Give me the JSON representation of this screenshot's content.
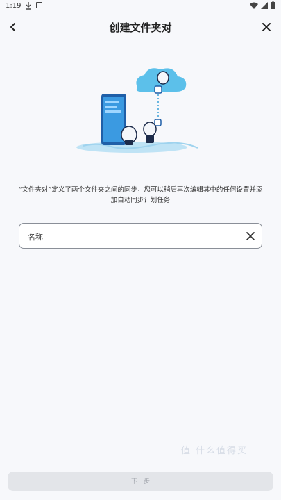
{
  "status_bar": {
    "time": "1:19"
  },
  "header": {
    "title": "创建文件夹对"
  },
  "description": "“文件夹对”定义了两个文件夹之间的同步，您可以稍后再次编辑其中的任何设置并添加自动同步计划任务",
  "name_field": {
    "placeholder": "名称",
    "value": ""
  },
  "footer": {
    "next_label": "下一步"
  },
  "watermark": "值 什么值得买",
  "colors": {
    "accent": "#3aa0d8",
    "background": "#f7f8fb",
    "button_disabled": "#e3e5e9"
  }
}
